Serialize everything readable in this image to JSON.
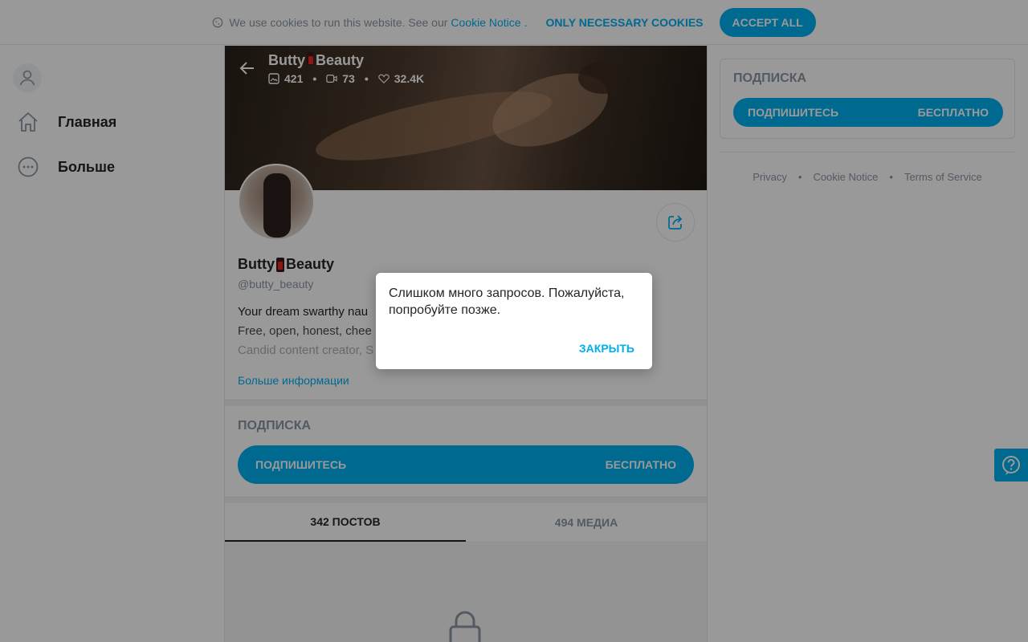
{
  "cookie_bar": {
    "text": "We use cookies to run this website. See our",
    "link": "Cookie Notice",
    "dot": ".",
    "necessary_label": "ONLY NECESSARY COOKIES",
    "accept_label": "ACCEPT ALL"
  },
  "nav": {
    "items": [
      {
        "label": "Главная",
        "icon": "home-icon"
      },
      {
        "label": "Больше",
        "icon": "more-icon"
      }
    ]
  },
  "profile": {
    "name_first": "Butty",
    "name_second": "Beauty",
    "stats": {
      "photos": "421",
      "videos": "73",
      "likes": "32.4K"
    },
    "handle": "@butty_beauty",
    "bio_lines": [
      "Your dream swarthy nau",
      "Free, open, honest, chee",
      "Candid content creator, S"
    ],
    "more_info": "Больше информации"
  },
  "subscription": {
    "title": "ПОДПИСКА",
    "button_label": "ПОДПИШИТЕСЬ",
    "button_price": "БЕСПЛАТНО"
  },
  "tabs": [
    {
      "label": "342 ПОСТОВ",
      "active": true
    },
    {
      "label": "494 МЕДИА",
      "active": false
    }
  ],
  "sidebar": {
    "title": "ПОДПИСКА",
    "button_label": "ПОДПИШИТЕСЬ",
    "button_price": "БЕСПЛАТНО",
    "footer_links": [
      "Privacy",
      "Cookie Notice",
      "Terms of Service"
    ]
  },
  "modal": {
    "message": "Слишком много запросов. Пожалуйста, попробуйте позже.",
    "close_label": "ЗАКРЫТЬ"
  },
  "colors": {
    "accent": "#00aff0",
    "text": "#242529",
    "muted": "#8a96a3"
  }
}
